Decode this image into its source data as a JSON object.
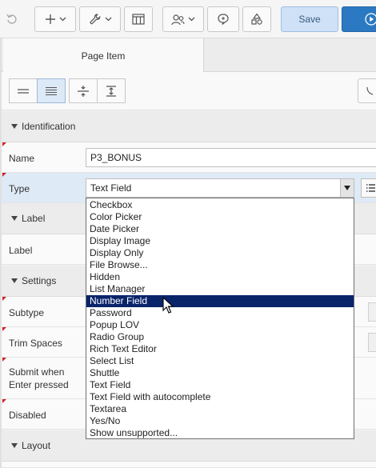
{
  "toolbar": {
    "buttons": [
      {
        "name": "undo-icon"
      },
      {
        "name": "create-menu",
        "icon": "plus-icon"
      },
      {
        "name": "utilities-menu",
        "icon": "wrench-icon"
      },
      {
        "name": "layout-grid",
        "icon": "grid-icon"
      },
      {
        "name": "shared-components-menu",
        "icon": "users-icon"
      },
      {
        "name": "comments",
        "icon": "comment-icon"
      },
      {
        "name": "shapes",
        "icon": "shapes-icon"
      }
    ],
    "save_label": "Save",
    "run_icon": "play-icon"
  },
  "tabs": {
    "page_item": "Page Item"
  },
  "layout_buttons": [
    "one-column-icon",
    "two-column-icon",
    "collapse-icon",
    "expand-icon"
  ],
  "sections": {
    "identification": "Identification",
    "label": "Label",
    "settings": "Settings",
    "layout": "Layout"
  },
  "fields": {
    "name_label": "Name",
    "name_value": "P3_BONUS",
    "type_label": "Type",
    "type_value": "Text Field",
    "label_label": "Label",
    "subtype_label": "Subtype",
    "trim_label": "Trim Spaces",
    "submit_label_1": "Submit when",
    "submit_label_2": "Enter pressed",
    "disabled_label": "Disabled"
  },
  "type_options": [
    "Checkbox",
    "Color Picker",
    "Date Picker",
    "Display Image",
    "Display Only",
    "File Browse...",
    "Hidden",
    "List Manager",
    "Number Field",
    "Password",
    "Popup LOV",
    "Radio Group",
    "Rich Text Editor",
    "Select List",
    "Shuttle",
    "Text Field",
    "Text Field with autocomplete",
    "Textarea",
    "Yes/No",
    "Show unsupported..."
  ],
  "highlighted_option": "Number Field",
  "colors": {
    "accent": "#2b79c2",
    "selection": "#0a246a",
    "required_flag": "#d02020"
  }
}
